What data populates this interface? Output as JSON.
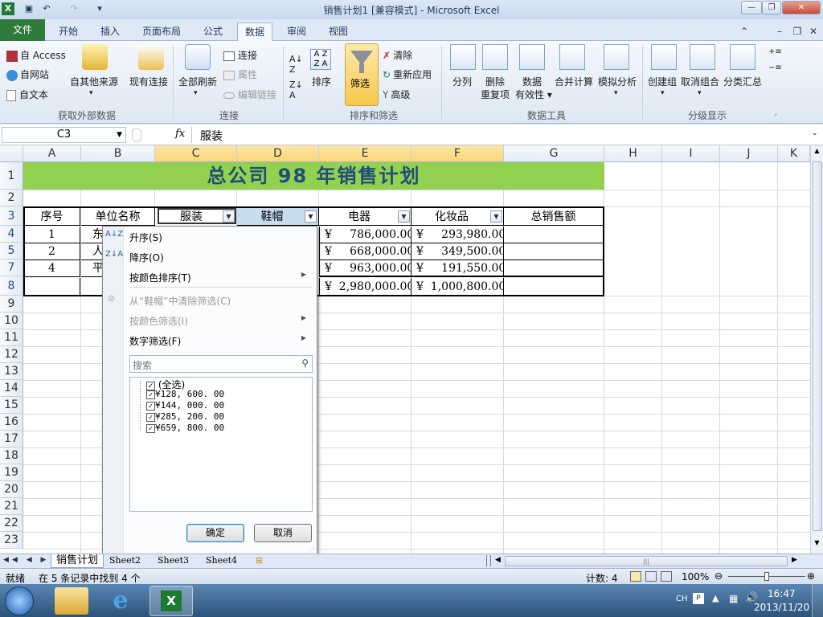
{
  "window": {
    "title": "销售计划1  [兼容模式] - Microsoft Excel"
  },
  "tabs": [
    "文件",
    "开始",
    "插入",
    "页面布局",
    "公式",
    "数据",
    "审阅",
    "视图"
  ],
  "ribbon": {
    "access": "自 Access",
    "web": "自网站",
    "text": "自文本",
    "other_sources": "自其他来源",
    "existing": "现有连接",
    "refresh_all": "全部刷新",
    "connections": "连接",
    "properties": "属性",
    "edit_links": "编辑链接",
    "sort_az": "A↓",
    "sort": "排序",
    "filter": "筛选",
    "clear": "清除",
    "reapply": "重新应用",
    "advanced": "高级",
    "split": "分列",
    "remove_dup_1": "删除",
    "remove_dup_2": "重复项",
    "validation_1": "数据",
    "validation_2": "有效性",
    "consolidate": "合并计算",
    "whatif": "模拟分析",
    "group": "创建组",
    "ungroup": "取消组合",
    "subtotal": "分类汇总",
    "groups": {
      "external": "获取外部数据",
      "connections": "连接",
      "sortfilter": "排序和筛选",
      "datatools": "数据工具",
      "outline": "分级显示"
    }
  },
  "formula_bar": {
    "name_box": "C3",
    "fx": "fx",
    "value": "服装"
  },
  "columns": [
    "A",
    "B",
    "C",
    "D",
    "E",
    "F",
    "G",
    "H",
    "I",
    "J",
    "K"
  ],
  "rows": [
    "1",
    "2",
    "3",
    "4",
    "5",
    "7",
    "8",
    "9",
    "10",
    "11",
    "12",
    "13",
    "14",
    "15",
    "16",
    "17",
    "18",
    "19",
    "20",
    "21",
    "22",
    "23"
  ],
  "sheet": {
    "title": "总公司 98 年销售计划",
    "headers": {
      "seq": "序号",
      "unit": "单位名称",
      "clothes": "服装",
      "shoes": "鞋帽",
      "electric": "电器",
      "cosmetics": "化妆品",
      "total": "总销售额"
    },
    "rows": [
      {
        "seq": "1",
        "unit": "东",
        "electric": "¥     786,000.00",
        "cosmetics": "¥     293,980.00"
      },
      {
        "seq": "2",
        "unit": "人",
        "electric": "¥     668,000.00",
        "cosmetics": "¥     349,500.00"
      },
      {
        "seq": "4",
        "unit": "平",
        "electric": "¥     963,000.00",
        "cosmetics": "¥     191,550.00"
      },
      {
        "seq": "",
        "unit": "",
        "electric": "¥  2,980,000.00",
        "cosmetics": "¥  1,000,800.00"
      }
    ]
  },
  "dropdown": {
    "sort_asc": "升序(S)",
    "sort_desc": "降序(O)",
    "sort_color": "按颜色排序(T)",
    "clear_filter": "从“鞋帽”中清除筛选(C)",
    "filter_color": "按颜色筛选(I)",
    "number_filter": "数字筛选(F)",
    "search_placeholder": "搜索",
    "items": [
      "(全选)",
      "¥128, 600. 00",
      "¥144, 000. 00",
      "¥285, 200. 00",
      "¥659, 800. 00"
    ],
    "ok": "确定",
    "cancel": "取消"
  },
  "sheet_tabs": [
    "销售计划",
    "Sheet2",
    "Sheet3",
    "Sheet4"
  ],
  "status": {
    "ready": "就绪",
    "found": "在 5 条记录中找到 4 个",
    "count": "计数: 4",
    "zoom": "100%"
  },
  "taskbar": {
    "lang": "CH",
    "time": "16:47",
    "date": "2013/11/20"
  },
  "colors": {
    "title_fill": "#92d050",
    "title_text": "#1f4e79",
    "file_tab": "#2d7a3a",
    "selected_header": "#f9d776"
  }
}
